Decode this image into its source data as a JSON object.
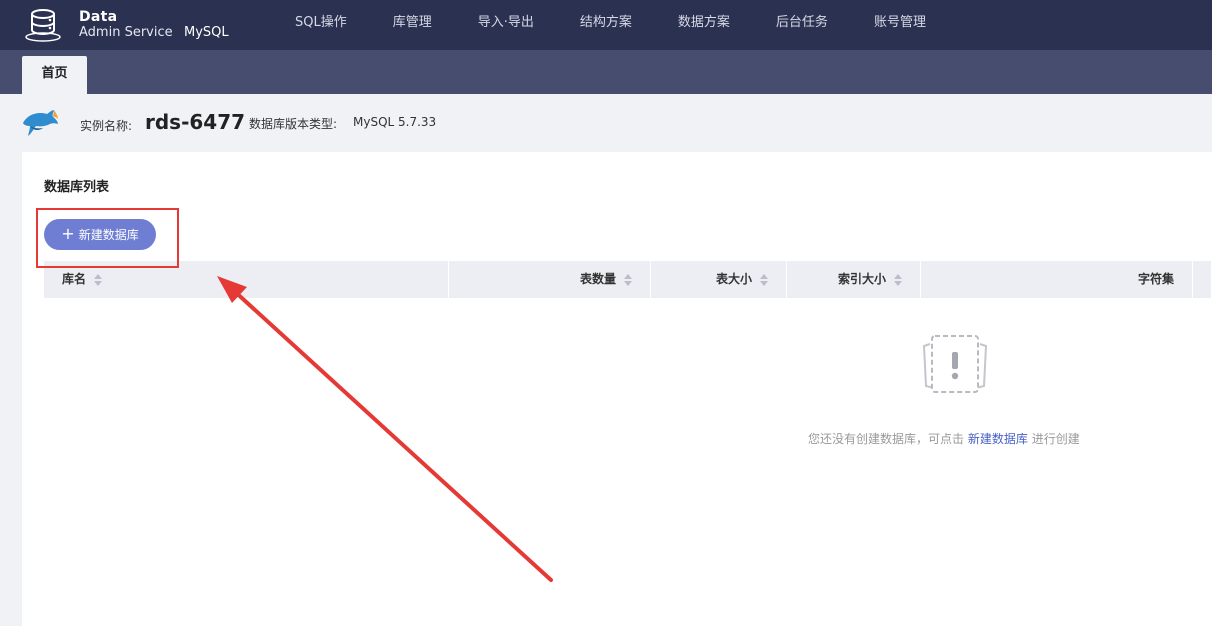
{
  "header": {
    "brand_title": "Data",
    "brand_subtitle": "Admin Service",
    "brand_product": "MySQL",
    "nav": [
      "SQL操作",
      "库管理",
      "导入·导出",
      "结构方案",
      "数据方案",
      "后台任务",
      "账号管理"
    ]
  },
  "tabs": {
    "home": "首页"
  },
  "instance": {
    "name_label": "实例名称:",
    "name": "rds-6477",
    "version_label": "数据库版本类型:",
    "version": "MySQL 5.7.33"
  },
  "panel": {
    "title": "数据库列表",
    "new_button": "新建数据库",
    "columns": [
      "库名",
      "表数量",
      "表大小",
      "索引大小",
      "字符集"
    ],
    "empty": {
      "prefix": "您还没有创建数据库，可点击",
      "link": "新建数据库",
      "suffix": "进行创建"
    }
  },
  "colors": {
    "topbar": "#2b3151",
    "tabbar": "#474d6e",
    "primary_button": "#6f7ed3",
    "annotation": "#e53935",
    "link": "#4760c4"
  },
  "icons": [
    "database-logo-icon",
    "dolphin-icon",
    "plus-icon",
    "sort-icon",
    "empty-state-icon"
  ]
}
